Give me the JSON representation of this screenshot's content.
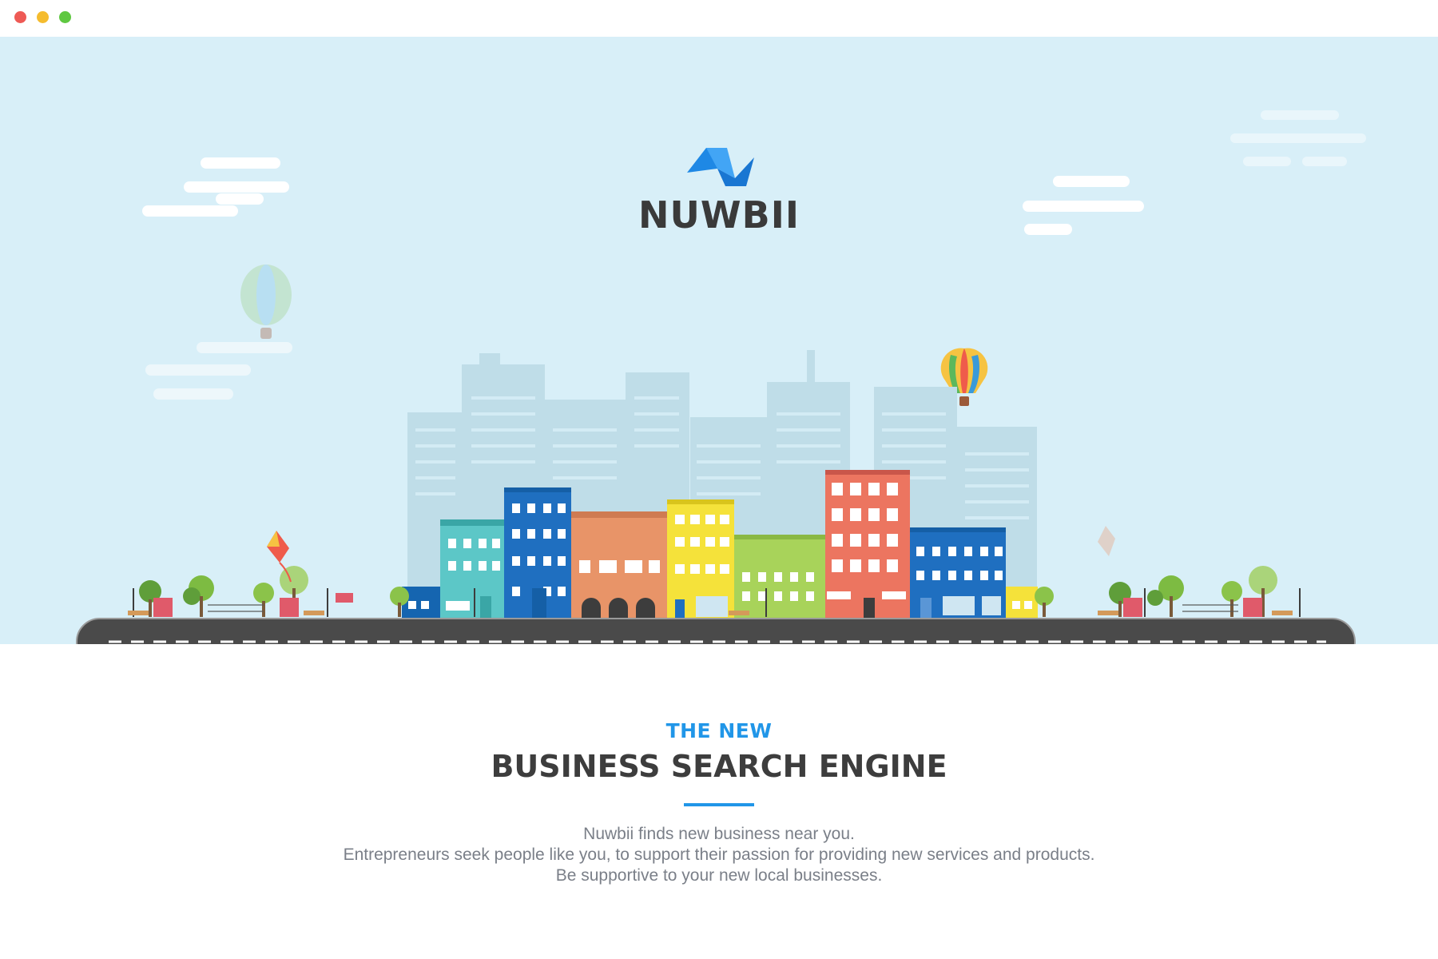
{
  "window": {
    "controls": [
      "close",
      "minimize",
      "maximize"
    ]
  },
  "brand": {
    "name": "NUWBII",
    "logo_icon": "nuwbii-bird-logo-icon",
    "accent": "#2196e8"
  },
  "hero": {
    "sky_color": "#d8eff8",
    "illustration": "city-skyline-illustration"
  },
  "intro": {
    "eyebrow": "THE NEW",
    "headline": "BUSINESS SEARCH ENGINE",
    "lines": [
      "Nuwbii finds new business near you.",
      "Entrepreneurs seek people like you, to support their passion for providing new services and products.",
      "Be supportive to your new local businesses."
    ]
  },
  "colors": {
    "text_dark": "#3d3d3d",
    "text_muted": "#7a7f88",
    "road": "#4a4a4a"
  }
}
